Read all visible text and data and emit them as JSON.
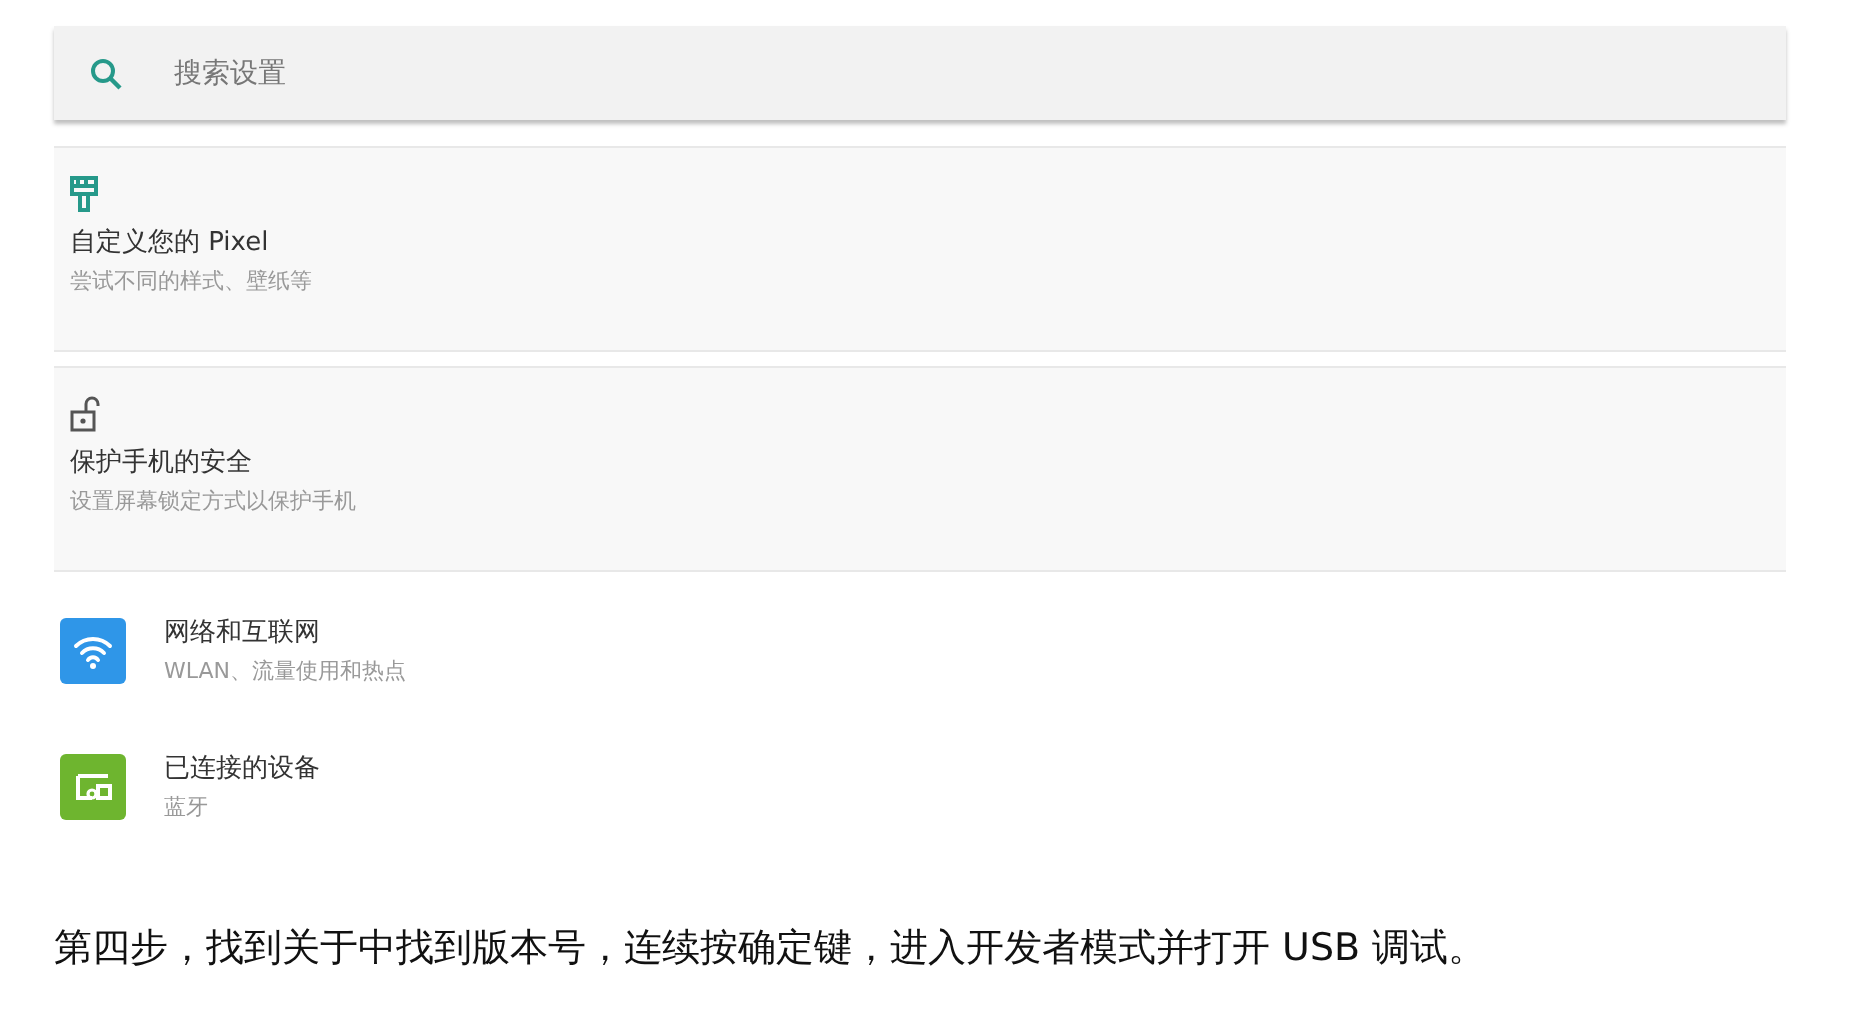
{
  "search": {
    "placeholder": "搜索设置"
  },
  "suggestions": [
    {
      "title": "自定义您的 Pixel",
      "subtitle": "尝试不同的样式、壁纸等"
    },
    {
      "title": "保护手机的安全",
      "subtitle": "设置屏幕锁定方式以保护手机"
    }
  ],
  "settings": [
    {
      "title": "网络和互联网",
      "subtitle": "WLAN、流量使用和热点",
      "color": "#2f96e8"
    },
    {
      "title": "已连接的设备",
      "subtitle": "蓝牙",
      "color": "#6eb52f"
    }
  ],
  "caption": "第四步，找到关于中找到版本号，连续按确定键，进入开发者模式并打开 USB 调试。"
}
